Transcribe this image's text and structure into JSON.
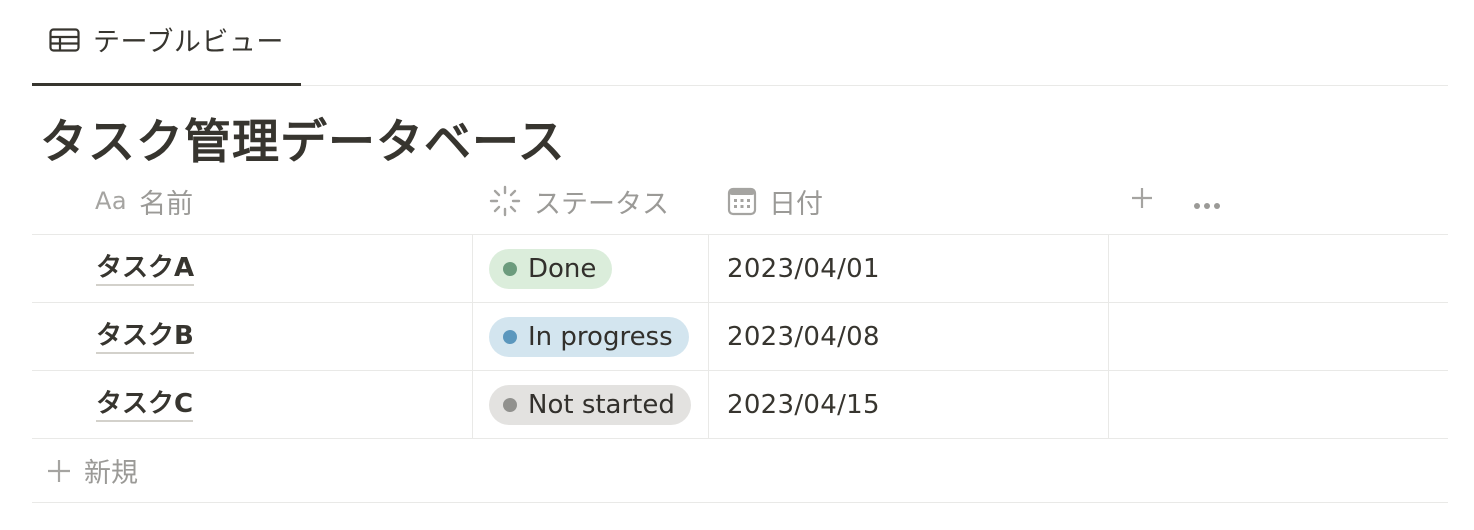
{
  "view_tab": {
    "label": "テーブルビュー",
    "icon": "table-icon"
  },
  "database": {
    "title": "タスク管理データベース"
  },
  "columns": [
    {
      "label": "名前",
      "icon": "text-property-icon",
      "icon_text": "Aa"
    },
    {
      "label": "ステータス",
      "icon": "status-property-icon"
    },
    {
      "label": "日付",
      "icon": "calendar-icon"
    }
  ],
  "header_actions": {
    "add_icon": "plus-icon",
    "more_icon": "ellipsis-icon"
  },
  "rows": [
    {
      "name": "タスクA",
      "status": {
        "label": "Done",
        "bg": "#dbeddb",
        "dot": "#6c9b7d"
      },
      "date": "2023/04/01"
    },
    {
      "name": "タスクB",
      "status": {
        "label": "In progress",
        "bg": "#d3e5ef",
        "dot": "#5b97bd"
      },
      "date": "2023/04/08"
    },
    {
      "name": "タスクC",
      "status": {
        "label": "Not started",
        "bg": "#e3e2e0",
        "dot": "#91918e"
      },
      "date": "2023/04/15"
    }
  ],
  "new_row": {
    "label": "新規",
    "icon": "plus-icon"
  },
  "colors": {
    "text": "#37352f",
    "muted": "#9b9a97",
    "border": "#e9e9e7"
  }
}
